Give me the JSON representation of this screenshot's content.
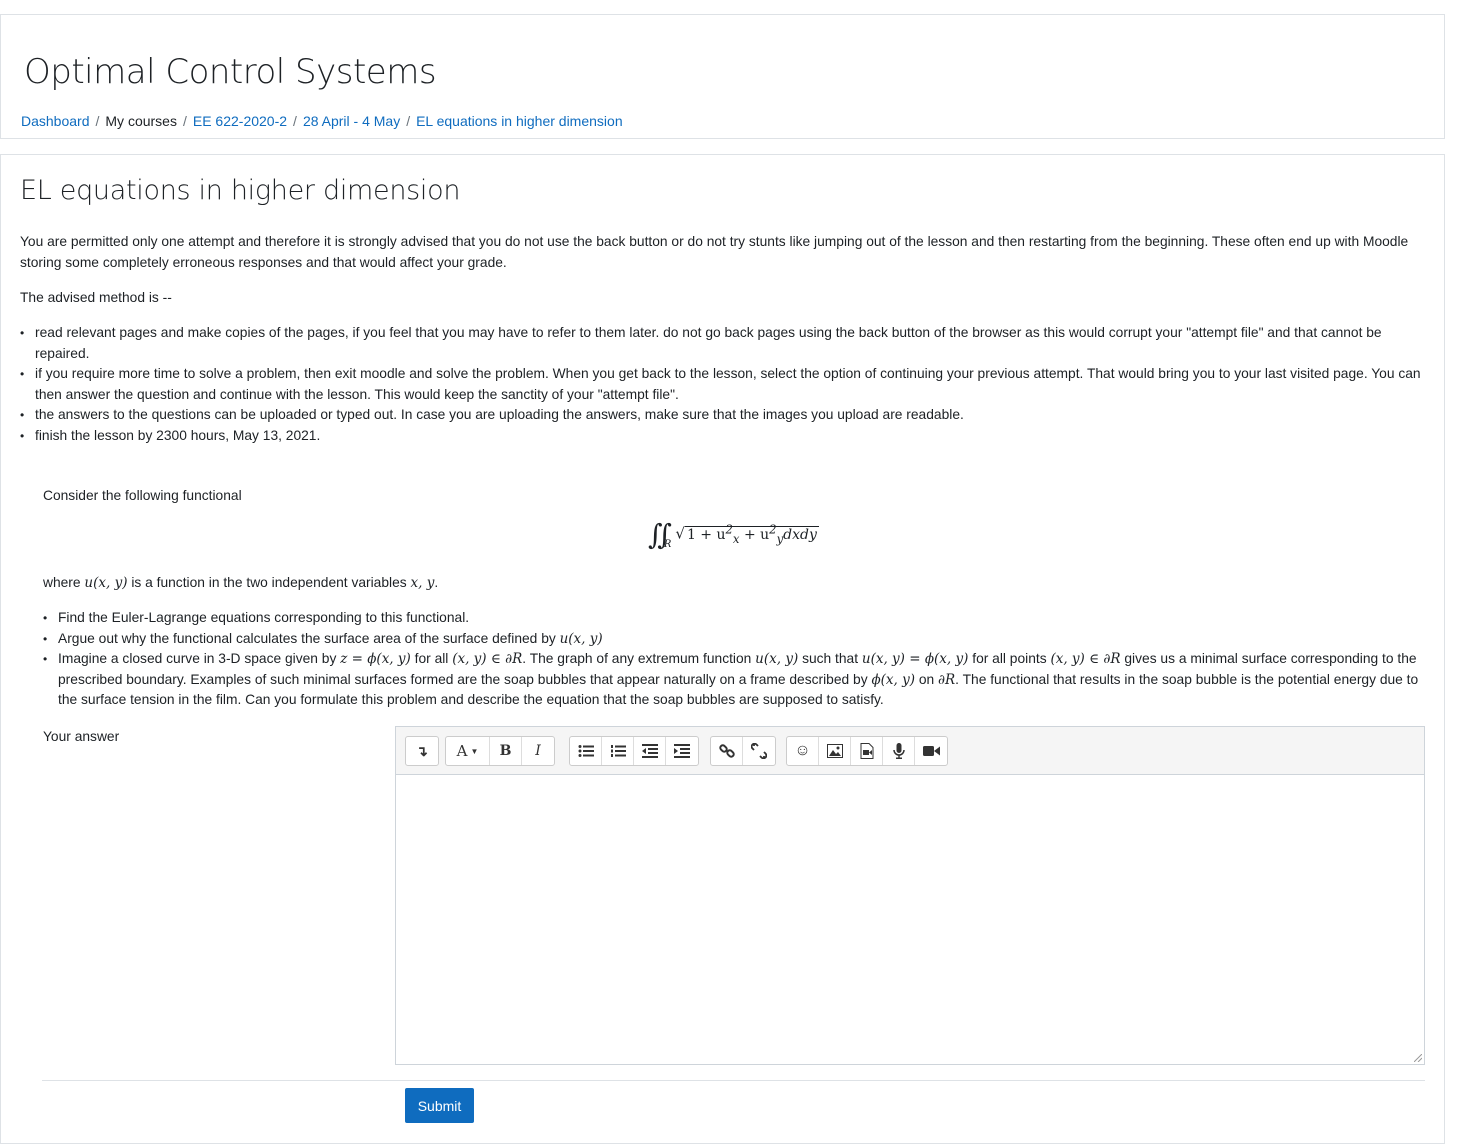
{
  "header": {
    "course_title": "Optimal Control Systems",
    "breadcrumb": [
      {
        "label": "Dashboard",
        "link": true
      },
      {
        "label": "My courses",
        "link": false
      },
      {
        "label": "EE 622-2020-2",
        "link": true
      },
      {
        "label": "28 April - 4 May",
        "link": true
      },
      {
        "label": "EL equations in higher dimension",
        "link": true
      }
    ],
    "separator": "/"
  },
  "lesson": {
    "title": "EL equations in higher dimension",
    "intro": "You are permitted only one attempt and therefore it is strongly advised that you do not use the back button or do not try stunts like jumping out of the lesson and then restarting from the beginning. These often end up with Moodle storing some completely erroneous responses and that would affect your grade.",
    "advised": "The advised method is --",
    "rules": [
      "read relevant pages and make copies of the pages, if you feel that you may have to refer to them later. do not go back pages using the back button of the browser as this would corrupt your \"attempt file\" and that cannot be repaired.",
      "if you require more time to solve a problem, then exit moodle and solve the problem. When you get back to the lesson, select the option of continuing your previous attempt. That would bring you to your last visited page. You can then answer the question and continue with the lesson. This would keep the sanctity of your \"attempt file\".",
      "the answers to the questions can be uploaded or typed out. In case you are uploading the answers, make sure that the images you upload are readable.",
      "finish the lesson by 2300 hours, May 13, 2021."
    ]
  },
  "question": {
    "consider": "Consider the following functional",
    "formula": {
      "integral": "∬",
      "region": "R",
      "radicand": "1 + u",
      "term2": " + u",
      "tail": "dxdy",
      "sup": "2",
      "sub_x": "x",
      "sub_y": "y"
    },
    "where": {
      "t1": "where ",
      "m1": "u(x, y)",
      "t2": " is a function in the two independent variables ",
      "m2": "x, y",
      "t3": "."
    },
    "tasks": {
      "t1": "Find the Euler-Lagrange equations corresponding to this functional.",
      "t2a": "Argue out why the functional calculates the surface area of the surface defined by ",
      "t2m": "u(x, y)",
      "t3a": "Imagine a closed curve in 3-D space given by ",
      "t3m1": "z = ϕ(x, y)",
      "t3b": " for all ",
      "t3m2": "(x, y) ∈ ∂R",
      "t3c": ". The graph of any extremum function ",
      "t3m3": "u(x, y)",
      "t3d": " such that ",
      "t3m4": "u(x, y) = ϕ(x, y)",
      "t3e": " for all points ",
      "t3m5": "(x, y) ∈ ∂R",
      "t3f": " gives us a minimal surface corresponding to the prescribed boundary.  Examples of such minimal surfaces formed are the soap bubbles that appear naturally on a frame described by ",
      "t3m6": "ϕ(x, y)",
      "t3g": " on ",
      "t3m7": "∂R",
      "t3h": ". The functional that results in the soap bubble is the potential energy due to the surface tension in the film. Can you formulate this problem and describe the equation that the soap bubbles are supposed to satisfy."
    }
  },
  "answer": {
    "label": "Your answer",
    "toolbar": {
      "toggle_icon": "↴",
      "font_label": "A",
      "bold_label": "B",
      "italic_label": "I",
      "emoji_icon": "☺"
    },
    "value": ""
  },
  "submit_label": "Submit"
}
